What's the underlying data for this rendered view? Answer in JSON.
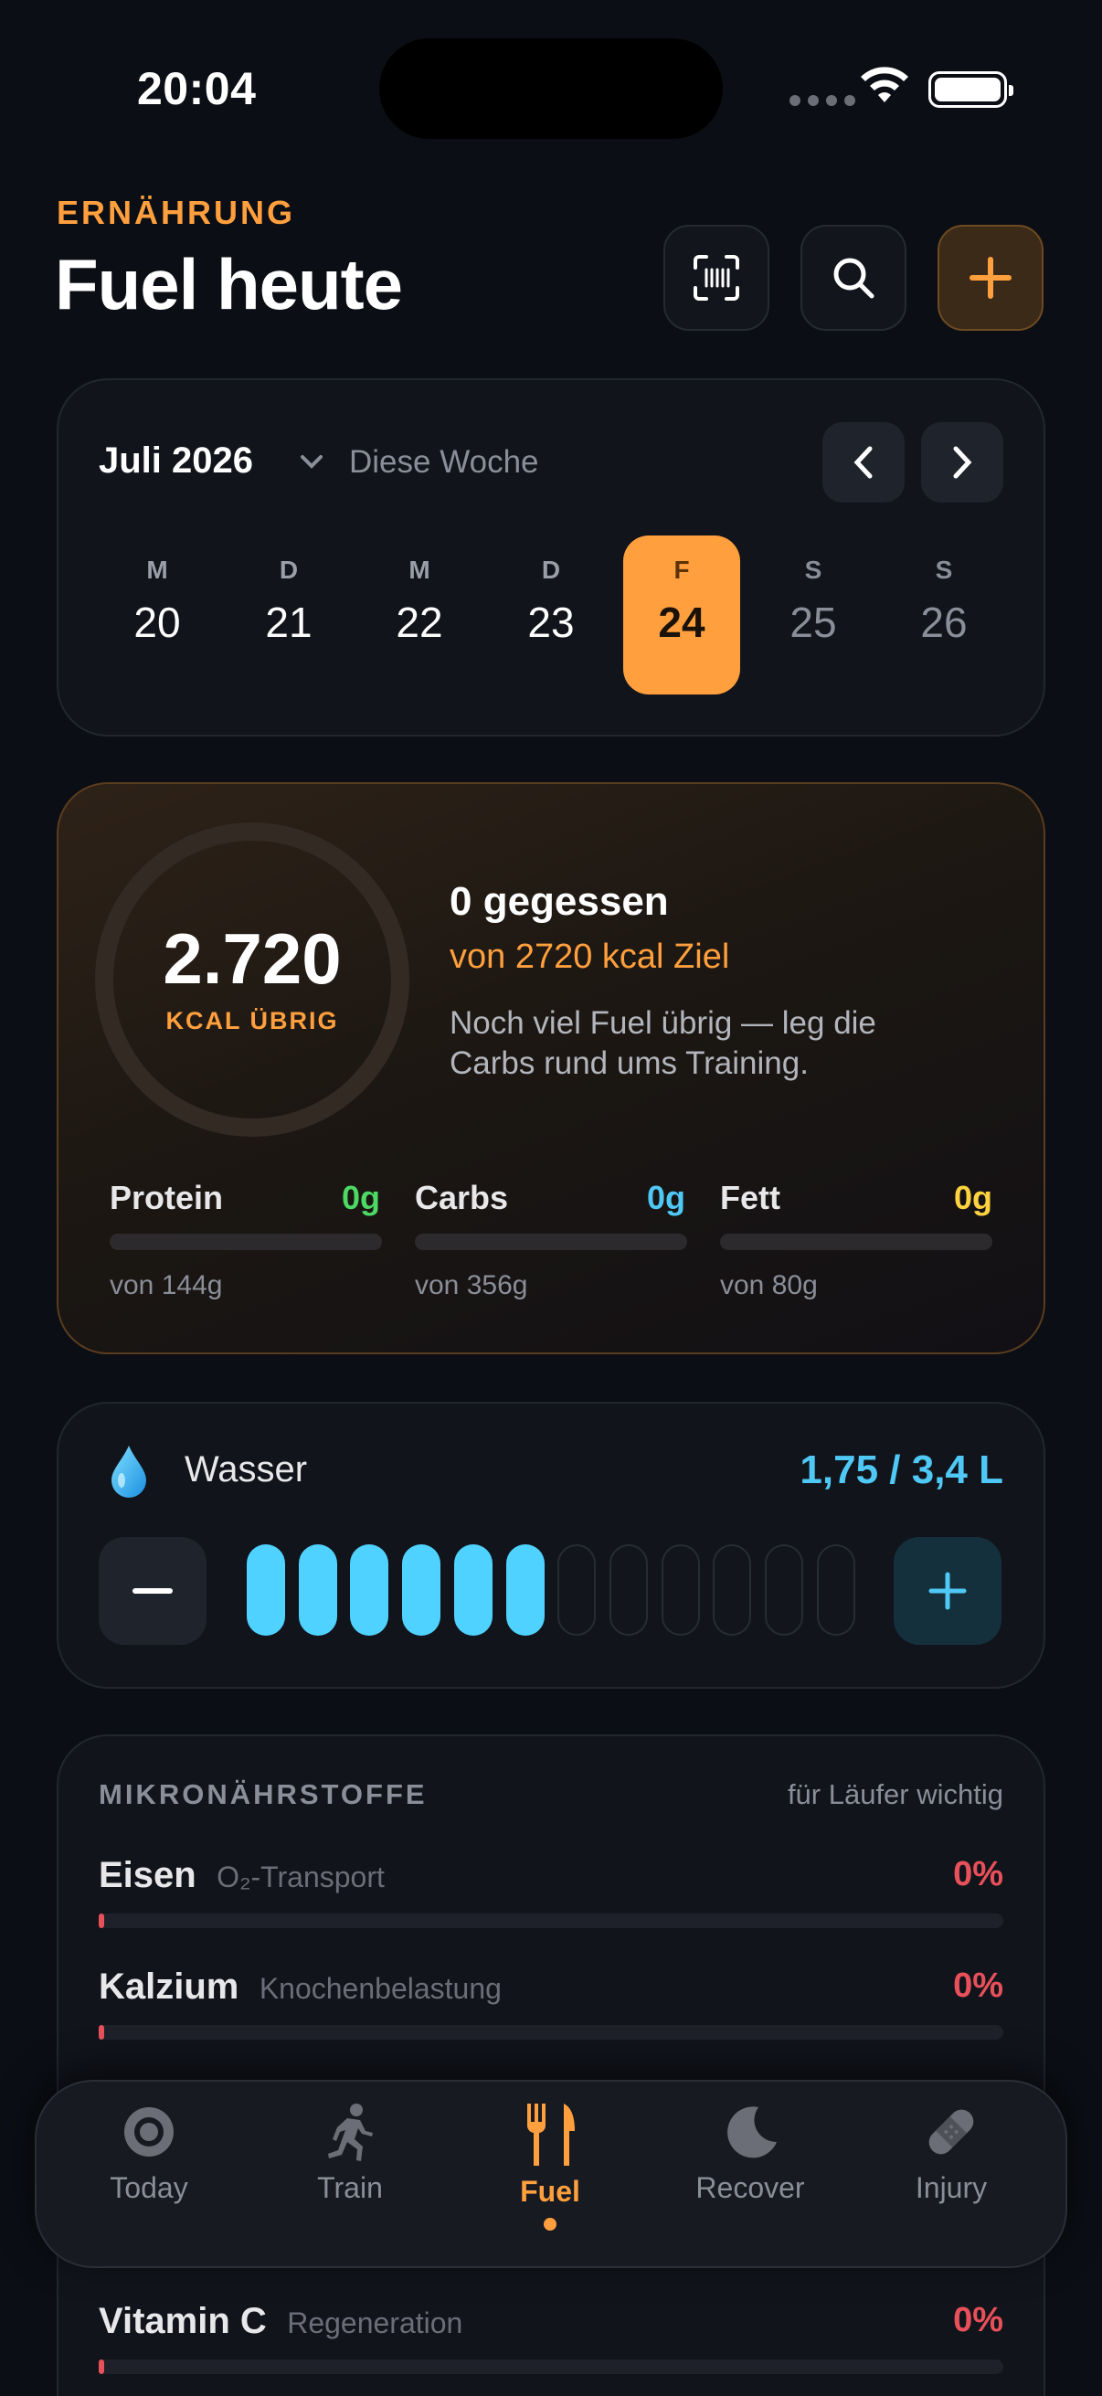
{
  "status": {
    "time": "20:04"
  },
  "header": {
    "eyebrow": "ERNÄHRUNG",
    "title": "Fuel heute"
  },
  "calendar": {
    "month": "Juli 2026",
    "range": "Diese Woche",
    "days": [
      {
        "letter": "M",
        "num": "20"
      },
      {
        "letter": "D",
        "num": "21"
      },
      {
        "letter": "M",
        "num": "22"
      },
      {
        "letter": "D",
        "num": "23"
      },
      {
        "letter": "F",
        "num": "24",
        "selected": true
      },
      {
        "letter": "S",
        "num": "25"
      },
      {
        "letter": "S",
        "num": "26"
      }
    ]
  },
  "calories": {
    "remaining": "2.720",
    "remaining_label": "KCAL ÜBRIG",
    "eaten": "0 gegessen",
    "goal": "von 2720 kcal Ziel",
    "tip": "Noch viel Fuel übrig — leg die Carbs rund ums Training.",
    "progress": 0,
    "macros": [
      {
        "name": "Protein",
        "value": "0g",
        "of": "von 144g",
        "color": "#4cd964"
      },
      {
        "name": "Carbs",
        "value": "0g",
        "of": "von 356g",
        "color": "#4fc8f5"
      },
      {
        "name": "Fett",
        "value": "0g",
        "of": "von 80g",
        "color": "#ffd23f"
      }
    ]
  },
  "water": {
    "label": "Wasser",
    "value": "1,75 / 3,4 L",
    "glasses_filled": 6,
    "glasses_total": 12
  },
  "micros": {
    "title": "MIKRONÄHRSTOFFE",
    "hint": "für Läufer wichtig",
    "items": [
      {
        "name": "Eisen",
        "desc": "O₂-Transport",
        "pct": "0%"
      },
      {
        "name": "Kalzium",
        "desc": "Knochenbelastung",
        "pct": "0%"
      },
      {
        "name": "Vitamin C",
        "desc": "Regeneration",
        "pct": "0%"
      }
    ]
  },
  "tabs": [
    {
      "label": "Today",
      "icon": "today-ring-icon"
    },
    {
      "label": "Train",
      "icon": "runner-icon"
    },
    {
      "label": "Fuel",
      "icon": "fork-knife-icon",
      "active": true
    },
    {
      "label": "Recover",
      "icon": "moon-icon"
    },
    {
      "label": "Injury",
      "icon": "bandage-icon"
    }
  ],
  "colors": {
    "accent": "#ff9f3d",
    "water": "#4fd2ff",
    "danger": "#e8505a",
    "background": "#0b0e14"
  }
}
